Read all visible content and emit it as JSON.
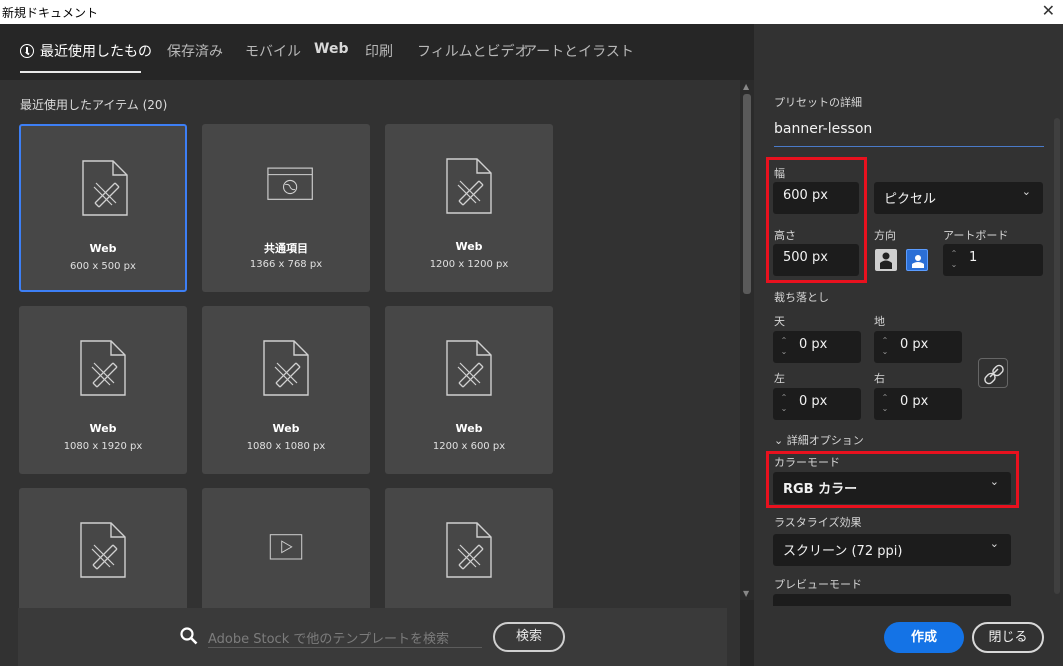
{
  "window": {
    "title": "新規ドキュメント",
    "close_glyph": "✕"
  },
  "tabs": [
    {
      "label": "最近使用したもの",
      "active": true
    },
    {
      "label": "保存済み"
    },
    {
      "label": "モバイル"
    },
    {
      "label": "Web"
    },
    {
      "label": "印刷"
    },
    {
      "label": "フィルムとビデオ"
    },
    {
      "label": "アートとイラスト"
    }
  ],
  "recent": {
    "title": "最近使用したアイテム (20)",
    "items": [
      {
        "name": "Web",
        "size": "600 x 500 px",
        "icon": "pen-document-icon",
        "selected": true
      },
      {
        "name": "共通項目",
        "size": "1366 x 768 px",
        "icon": "globe-browser-icon"
      },
      {
        "name": "Web",
        "size": "1200 x 1200 px",
        "icon": "pen-document-icon"
      },
      {
        "name": "Web",
        "size": "1080 x 1920 px",
        "icon": "pen-document-icon"
      },
      {
        "name": "Web",
        "size": "1080 x 1080 px",
        "icon": "pen-document-icon"
      },
      {
        "name": "Web",
        "size": "1200 x 600 px",
        "icon": "pen-document-icon"
      },
      {
        "name": "",
        "size": "",
        "icon": "pen-document-icon"
      },
      {
        "name": "",
        "size": "",
        "icon": "video-play-icon"
      },
      {
        "name": "",
        "size": "",
        "icon": "pen-document-icon"
      }
    ]
  },
  "search": {
    "placeholder": "Adobe Stock で他のテンプレートを検索",
    "button": "検索"
  },
  "preset": {
    "title": "プリセットの詳細",
    "name": "banner-lesson",
    "width_label": "幅",
    "width": "600 px",
    "unit": "ピクセル",
    "height_label": "高さ",
    "height": "500 px",
    "orientation_label": "方向",
    "artboard_label": "アートボード",
    "artboard_count": "1",
    "bleed_label": "裁ち落とし",
    "bleed": {
      "top_label": "天",
      "top": "0 px",
      "bottom_label": "地",
      "bottom": "0 px",
      "left_label": "左",
      "left": "0 px",
      "right_label": "右",
      "right": "0 px"
    },
    "advanced_label": "詳細オプション",
    "color_mode_label": "カラーモード",
    "color_mode": "RGB カラー",
    "raster_label": "ラスタライズ効果",
    "raster": "スクリーン (72 ppi)",
    "preview_label": "プレビューモード"
  },
  "actions": {
    "create": "作成",
    "close": "閉じる"
  },
  "colors": {
    "accent": "#1473e6",
    "selection": "#3d7ff5",
    "highlight_box": "#e8111e"
  }
}
